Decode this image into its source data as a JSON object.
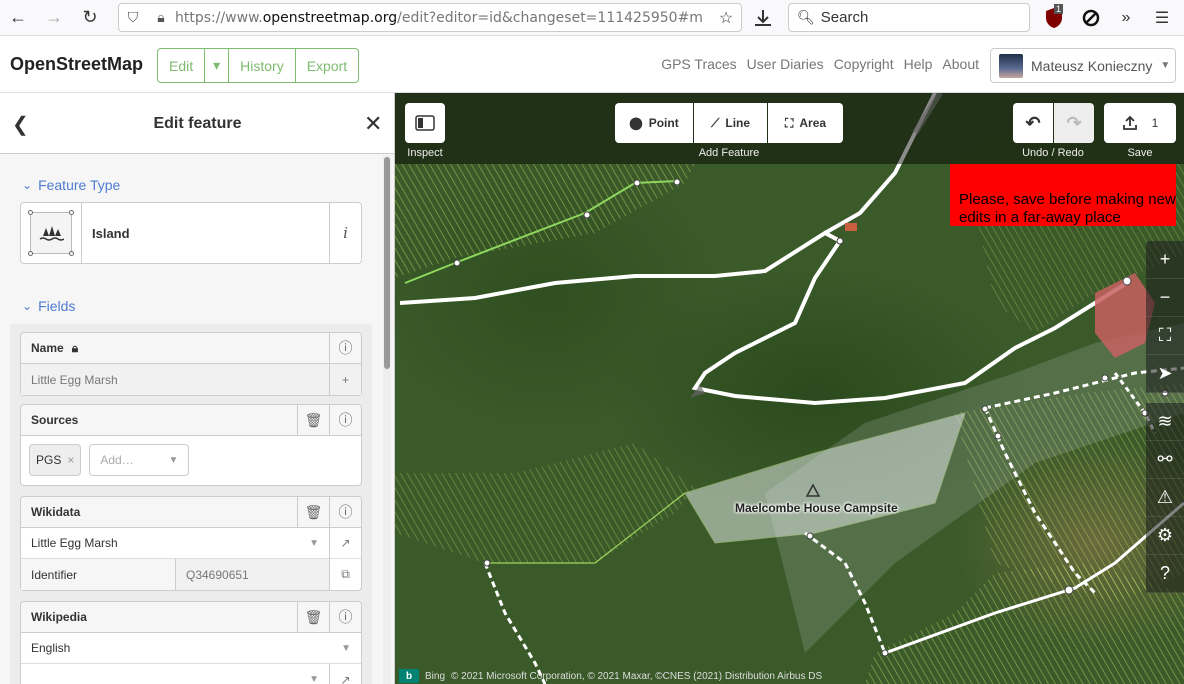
{
  "browser": {
    "url_prefix": "https://www.",
    "url_domain": "openstreetmap.org",
    "url_rest": "/edit?editor=id&changeset=111425950#m",
    "search_label": "Search",
    "ext_badge": "1"
  },
  "header": {
    "logo": "OpenStreetMap",
    "edit_label": "Edit",
    "history_label": "History",
    "export_label": "Export",
    "links": [
      "GPS Traces",
      "User Diaries",
      "Copyright",
      "Help",
      "About"
    ],
    "user_name": "Mateusz Konieczny"
  },
  "sidebar": {
    "title": "Edit feature",
    "feature_type_heading": "Feature Type",
    "preset_name": "Island",
    "fields_heading": "Fields",
    "name_label": "Name",
    "name_value": "Little Egg Marsh",
    "sources_label": "Sources",
    "sources_chip": "PGS",
    "sources_add_placeholder": "Add…",
    "wikidata_label": "Wikidata",
    "wikidata_value": "Little Egg Marsh",
    "identifier_label": "Identifier",
    "identifier_value": "Q34690651",
    "wikipedia_label": "Wikipedia",
    "wikipedia_language": "English"
  },
  "map": {
    "toolbar": {
      "inspect_label": "Inspect",
      "point_label": "Point",
      "line_label": "Line",
      "area_label": "Area",
      "add_feature_label": "Add Feature",
      "undo_redo_label": "Undo / Redo",
      "save_count": "1",
      "save_label": "Save"
    },
    "tooltip_text": "Please, save before making new edits in a far-away place",
    "campsite_label": "Maelcombe House Campsite",
    "attribution": {
      "bing": "Bing",
      "text": "© 2021 Microsoft Corporation, © 2021 Maxar, ©CNES (2021) Distribution Airbus DS"
    }
  },
  "colors": {
    "accent_green": "#7ebc6f",
    "heading_blue": "#4f7cd1",
    "tooltip_red": "#ff0000"
  }
}
